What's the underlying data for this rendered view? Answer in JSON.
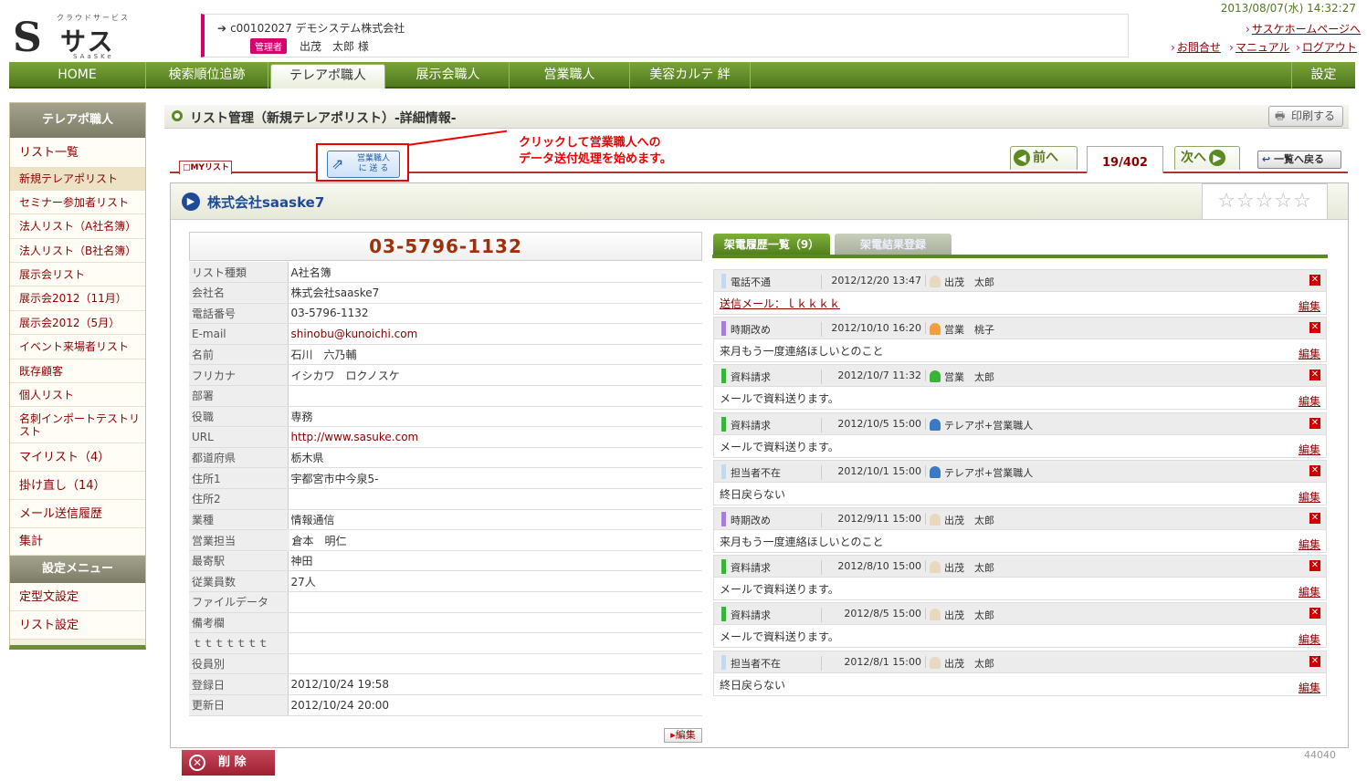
{
  "header": {
    "logo_sub": "クラウドサービス",
    "logo_name": "サスケ",
    "logo_romaji": "SAaSKe",
    "company_line": "c00102027  デモシステム株式会社",
    "role_badge": "管理者",
    "user_name": "出茂　太郎 様",
    "datetime": "2013/08/07(水) 14:32:27",
    "links": {
      "home": "サスケホームページへ",
      "contact": "お問合せ",
      "manual": "マニュアル",
      "logout": "ログアウト"
    }
  },
  "nav": [
    "HOME",
    "検索順位追跡",
    "テレアポ職人",
    "展示会職人",
    "営業職人",
    "美容カルテ 絆",
    "設定"
  ],
  "sidebar": {
    "title": "テレアポ職人",
    "items": [
      "リスト一覧",
      "新規テレアポリスト",
      "セミナー参加者リスト",
      "法人リスト（A社名簿）",
      "法人リスト（B社名簿）",
      "展示会リスト",
      "展示会2012（11月）",
      "展示会2012（5月）",
      "イベント来場者リスト",
      "既存顧客",
      "個人リスト",
      "名刺インポートテストリスト"
    ],
    "extra": [
      "マイリスト（4）",
      "掛け直し（14）",
      "メール送信履歴",
      "集計"
    ],
    "settings_title": "設定メニュー",
    "settings": [
      "定型文設定",
      "リスト設定"
    ]
  },
  "page": {
    "title": "リスト管理（新規テレアポリスト）-詳細情報-",
    "print": "印刷する",
    "mylist_tab": "□MYリスト",
    "send_line1": "営業職人",
    "send_line2": "に 送 る",
    "annotation_1": "クリックして営業職人への",
    "annotation_2": "データ送付処理を始めます。",
    "prev": "前へ",
    "next": "次へ",
    "pager": "19/402",
    "back": "一覧へ戻る"
  },
  "company": {
    "name": "株式会社saaske7",
    "stars": "☆☆☆☆☆",
    "phone": "03-5796-1132"
  },
  "details": [
    {
      "k": "リスト種類",
      "v": "A社名簿"
    },
    {
      "k": "会社名",
      "v": "株式会社saaske7"
    },
    {
      "k": "電話番号",
      "v": "03-5796-1132"
    },
    {
      "k": "E-mail",
      "v": "shinobu@kunoichi.com"
    },
    {
      "k": "名前",
      "v": "石川　六乃輔"
    },
    {
      "k": "フリカナ",
      "v": "イシカワ　ロクノスケ"
    },
    {
      "k": "部署",
      "v": ""
    },
    {
      "k": "役職",
      "v": "専務"
    },
    {
      "k": "URL",
      "v": "http://www.sasuke.com"
    },
    {
      "k": "都道府県",
      "v": "栃木県"
    },
    {
      "k": "住所1",
      "v": "宇都宮市中今泉5-"
    },
    {
      "k": "住所2",
      "v": ""
    },
    {
      "k": "業種",
      "v": "情報通信"
    },
    {
      "k": "営業担当",
      "v": "倉本　明仁"
    },
    {
      "k": "最寄駅",
      "v": "神田"
    },
    {
      "k": "従業員数",
      "v": "27人"
    },
    {
      "k": "ファイルデータ",
      "v": ""
    },
    {
      "k": "備考欄",
      "v": ""
    },
    {
      "k": "ｔｔｔｔｔｔｔ",
      "v": ""
    },
    {
      "k": "役員別",
      "v": ""
    },
    {
      "k": "登録日",
      "v": "2012/10/24 19:58"
    },
    {
      "k": "更新日",
      "v": "2012/10/24 20:00"
    }
  ],
  "edit": "編集",
  "delete": "削 除",
  "page_id": "44040",
  "history": {
    "tab_list": "架電履歴一覧（9）",
    "tab_register": "架電結果登録",
    "edit_label": "編集",
    "entries": [
      {
        "type": "電話不通",
        "date": "2012/12/20 13:47",
        "user": "出茂　太郎",
        "memo": "送信メール：ｌｋｋｋｋ",
        "color": "#c6d8ee"
      },
      {
        "type": "時期改め",
        "date": "2012/10/10 16:20",
        "user": "営業　桃子",
        "memo": "来月もう一度連絡ほしいとのこと",
        "color": "#a67ed8"
      },
      {
        "type": "資料請求",
        "date": "2012/10/7 11:32",
        "user": "営業　太郎",
        "memo": "メールで資料送ります。",
        "color": "#38b438"
      },
      {
        "type": "資料請求",
        "date": "2012/10/5 15:00",
        "user": "テレアポ+営業職人",
        "memo": "メールで資料送ります。",
        "color": "#38b438"
      },
      {
        "type": "担当者不在",
        "date": "2012/10/1 15:00",
        "user": "テレアポ+営業職人",
        "memo": "終日戻らない",
        "color": "#c6d8ee"
      },
      {
        "type": "時期改め",
        "date": "2012/9/11 15:00",
        "user": "出茂　太郎",
        "memo": "来月もう一度連絡ほしいとのこと",
        "color": "#a67ed8"
      },
      {
        "type": "資料請求",
        "date": "2012/8/10 15:00",
        "user": "出茂　太郎",
        "memo": "メールで資料送ります。",
        "color": "#38b438"
      },
      {
        "type": "資料請求",
        "date": "2012/8/5 15:00",
        "user": "出茂　太郎",
        "memo": "メールで資料送ります。",
        "color": "#38b438"
      },
      {
        "type": "担当者不在",
        "date": "2012/8/1 15:00",
        "user": "出茂　太郎",
        "memo": "終日戻らない",
        "color": "#c6d8ee"
      }
    ]
  }
}
